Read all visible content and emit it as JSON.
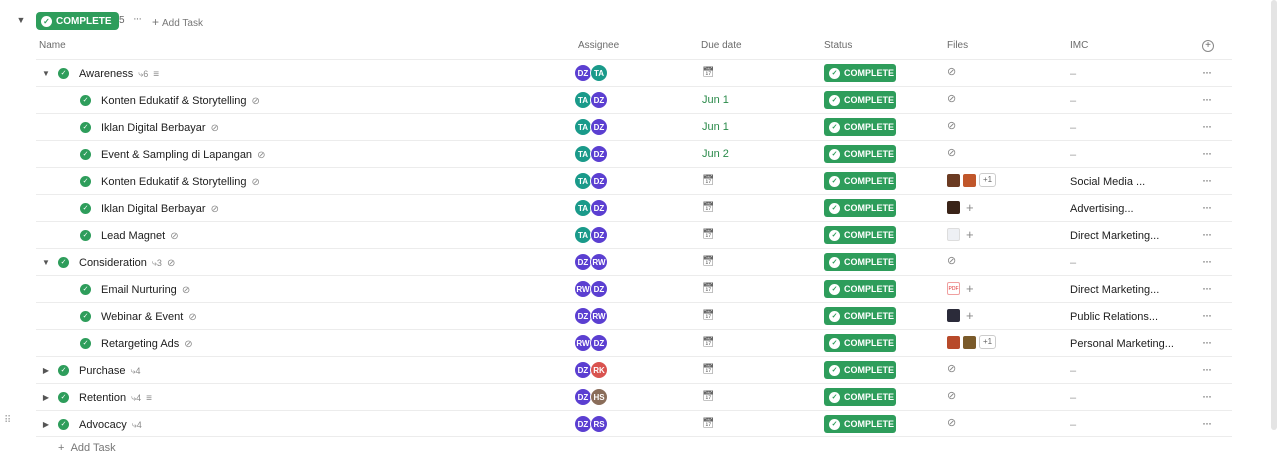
{
  "group": {
    "label": "COMPLETE",
    "count": "5",
    "more": "···",
    "add_task": "Add Task"
  },
  "columns": {
    "name": "Name",
    "assignee": "Assignee",
    "due": "Due date",
    "status": "Status",
    "files": "Files",
    "imc": "IMC"
  },
  "status_label": "COMPLETE",
  "add_task": "Add Task",
  "rows": [
    {
      "name": "Awareness",
      "sub": "6",
      "due": "",
      "imc": "–"
    },
    {
      "name": "Konten Edukatif & Storytelling",
      "due": "Jun 1",
      "imc": "–"
    },
    {
      "name": "Iklan Digital Berbayar",
      "due": "Jun 1",
      "imc": "–"
    },
    {
      "name": "Event & Sampling di Lapangan",
      "due": "Jun 2",
      "imc": "–"
    },
    {
      "name": "Konten Edukatif & Storytelling",
      "due": "",
      "imc": "Social Media ...",
      "files_more": "+1"
    },
    {
      "name": "Iklan Digital Berbayar",
      "due": "",
      "imc": "Advertising..."
    },
    {
      "name": "Lead Magnet",
      "due": "",
      "imc": "Direct Marketing..."
    },
    {
      "name": "Consideration",
      "sub": "3",
      "due": "",
      "imc": "–"
    },
    {
      "name": "Email Nurturing",
      "due": "",
      "imc": "Direct Marketing..."
    },
    {
      "name": "Webinar & Event",
      "due": "",
      "imc": "Public Relations..."
    },
    {
      "name": "Retargeting Ads",
      "due": "",
      "imc": "Personal Marketing...",
      "files_more": "+1"
    },
    {
      "name": "Purchase",
      "sub": "4",
      "due": "",
      "imc": "–"
    },
    {
      "name": "Retention",
      "sub": "4",
      "due": "",
      "imc": "–"
    },
    {
      "name": "Advocacy",
      "sub": "4",
      "due": "",
      "imc": "–"
    }
  ],
  "avatars": {
    "DZ": {
      "initials": "DZ",
      "color": "#5b3fd1"
    },
    "TA": {
      "initials": "TA",
      "color": "#1a9a8a"
    },
    "RW": {
      "initials": "RW",
      "color": "#5b3fd1"
    },
    "RK": {
      "initials": "RK",
      "color": "#d9534f"
    },
    "HS": {
      "initials": "HS",
      "color": "#8a6d5a"
    },
    "RS": {
      "initials": "RS",
      "color": "#5b3fd1"
    }
  },
  "colors": {
    "status_green": "#2e9d5b",
    "due_green": "#2a8a4a"
  }
}
